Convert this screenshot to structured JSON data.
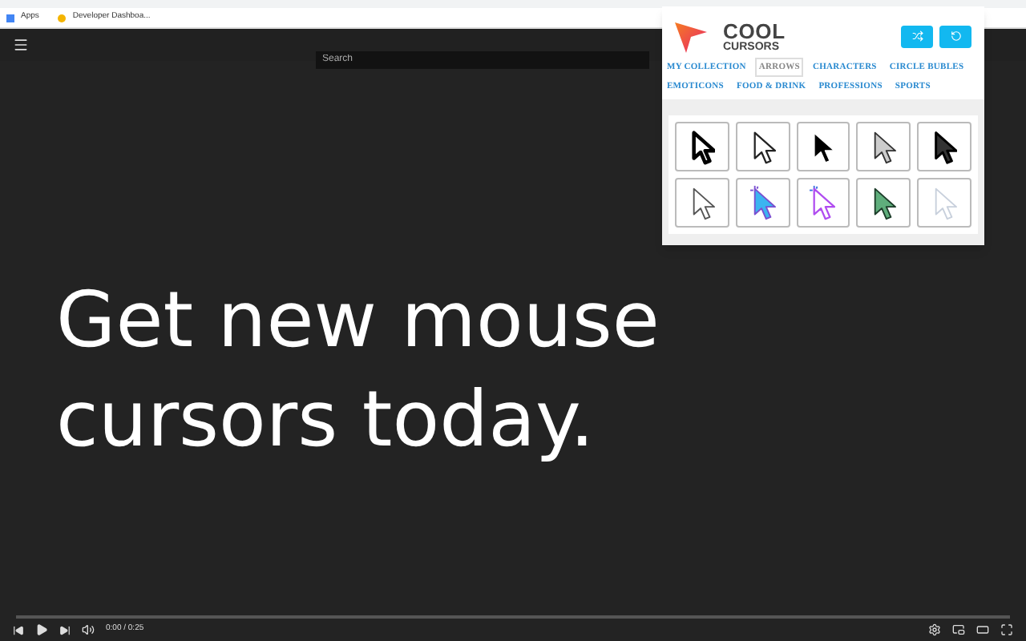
{
  "bookmarks": [
    {
      "label": "Apps"
    },
    {
      "label": "Developer Dashboa..."
    }
  ],
  "header": {
    "search": {
      "placeholder": "Search"
    }
  },
  "video": {
    "headline": "Get new mouse cursors today.",
    "time": "0:00 / 0:25",
    "progress": {
      "level": 0
    }
  },
  "popup": {
    "logo_top": "COOL",
    "logo_bottom": "CURSORS",
    "categories": [
      {
        "label": "MY COLLECTION",
        "selected": false
      },
      {
        "label": "ARROWS",
        "selected": true
      },
      {
        "label": "CHARACTERS",
        "selected": false
      },
      {
        "label": "CIRCLE BUBLES",
        "selected": false
      },
      {
        "label": "EMOTICONS",
        "selected": false
      },
      {
        "label": "FOOD & DRINK",
        "selected": false
      },
      {
        "label": "PROFESSIONS",
        "selected": false
      },
      {
        "label": "SPORTS",
        "selected": false
      }
    ],
    "cursors": [
      {
        "kind": "bold"
      },
      {
        "kind": "outline"
      },
      {
        "kind": "black"
      },
      {
        "kind": "gray"
      },
      {
        "kind": "pixel"
      },
      {
        "kind": "thin"
      },
      {
        "kind": "blue"
      },
      {
        "kind": "sparkle"
      },
      {
        "kind": "green"
      },
      {
        "kind": "faint"
      }
    ]
  }
}
